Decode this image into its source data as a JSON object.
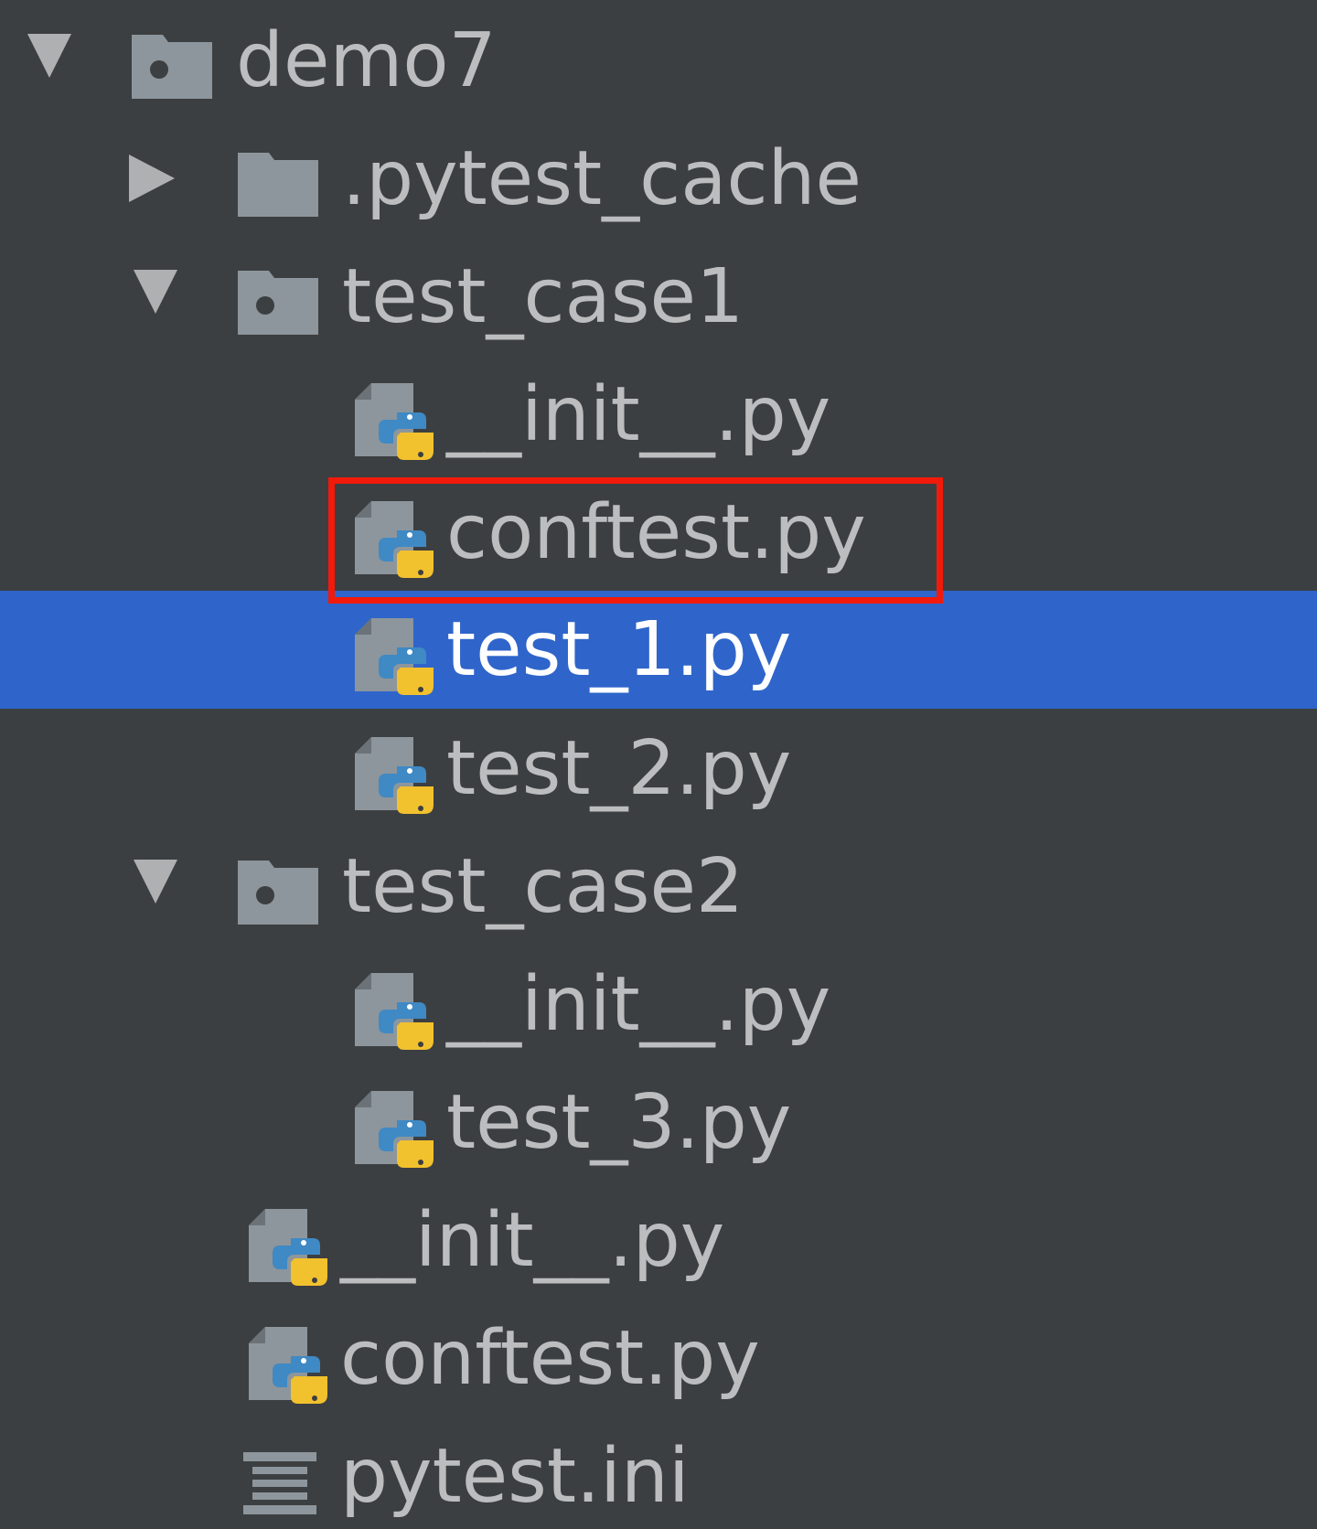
{
  "colors": {
    "background": "#3c3f41",
    "selection": "#2f65ca",
    "text": "#bbbdbf",
    "selected_text": "#ffffff",
    "highlight_border": "#f21a0a",
    "folder": "#8d969c",
    "python_blue": "#3f89c5",
    "python_yellow": "#f2c12e"
  },
  "tree": {
    "items": [
      {
        "label": "demo7",
        "icon": "module-folder-icon",
        "expander": "expanded"
      },
      {
        "label": ".pytest_cache",
        "icon": "folder-icon",
        "expander": "collapsed"
      },
      {
        "label": "test_case1",
        "icon": "module-folder-icon",
        "expander": "expanded"
      },
      {
        "label": "__init__.py",
        "icon": "python-file-icon",
        "expander": "none"
      },
      {
        "label": "conftest.py",
        "icon": "python-file-icon",
        "expander": "none",
        "highlighted": true
      },
      {
        "label": "test_1.py",
        "icon": "python-file-icon",
        "expander": "none",
        "selected": true
      },
      {
        "label": "test_2.py",
        "icon": "python-file-icon",
        "expander": "none"
      },
      {
        "label": "test_case2",
        "icon": "module-folder-icon",
        "expander": "expanded"
      },
      {
        "label": "__init__.py",
        "icon": "python-file-icon",
        "expander": "none"
      },
      {
        "label": "test_3.py",
        "icon": "python-file-icon",
        "expander": "none"
      },
      {
        "label": "__init__.py",
        "icon": "python-file-icon",
        "expander": "none"
      },
      {
        "label": "conftest.py",
        "icon": "python-file-icon",
        "expander": "none"
      },
      {
        "label": "pytest.ini",
        "icon": "settings-file-icon",
        "expander": "none"
      }
    ]
  }
}
